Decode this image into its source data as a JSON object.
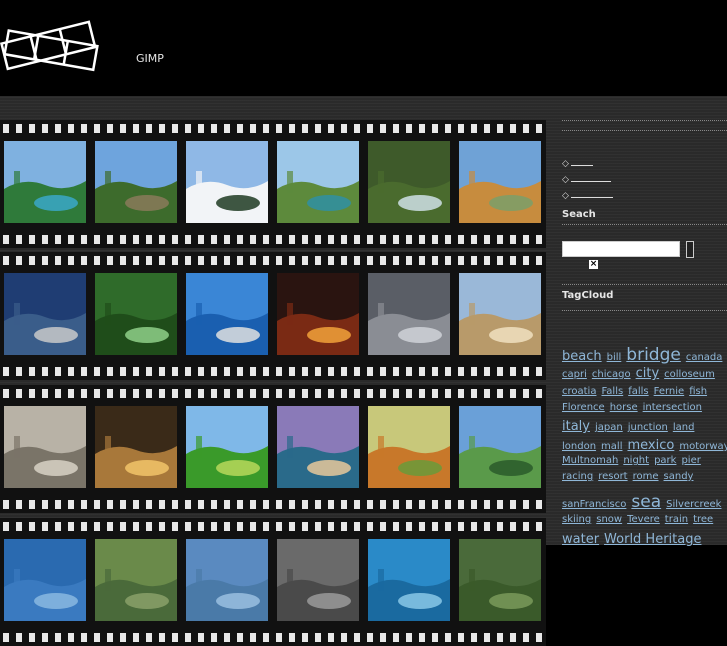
{
  "header": {
    "title": "GIMP"
  },
  "nav": {
    "items": [
      "",
      "",
      ""
    ]
  },
  "search": {
    "title": "Seach",
    "placeholder": ""
  },
  "tagcloud": {
    "title": "TagCloud",
    "rows": [
      [
        {
          "t": "beach",
          "s": 13
        },
        {
          "t": "bill",
          "s": 10
        },
        {
          "t": "bridge",
          "s": 17
        },
        {
          "t": "canada",
          "s": 10
        }
      ],
      [
        {
          "t": "capri",
          "s": 10
        },
        {
          "t": "chicago",
          "s": 10
        },
        {
          "t": "city",
          "s": 13
        },
        {
          "t": "colloseum",
          "s": 10
        }
      ],
      [
        {
          "t": "croatia",
          "s": 10
        },
        {
          "t": "Falls",
          "s": 10
        },
        {
          "t": "falls",
          "s": 10
        },
        {
          "t": "Fernie",
          "s": 10
        },
        {
          "t": "fish",
          "s": 10
        }
      ],
      [
        {
          "t": "Florence",
          "s": 10
        },
        {
          "t": "horse",
          "s": 10
        },
        {
          "t": "intersection",
          "s": 10
        }
      ],
      [
        {
          "t": "italy",
          "s": 13
        },
        {
          "t": "japan",
          "s": 10
        },
        {
          "t": "junction",
          "s": 10
        },
        {
          "t": "land",
          "s": 10
        }
      ],
      [
        {
          "t": "london",
          "s": 10
        },
        {
          "t": "mall",
          "s": 10
        },
        {
          "t": "mexico",
          "s": 13
        },
        {
          "t": "motorway",
          "s": 10
        }
      ],
      [
        {
          "t": "Multnomah",
          "s": 10
        },
        {
          "t": "night",
          "s": 10
        },
        {
          "t": "park",
          "s": 10
        },
        {
          "t": "pier",
          "s": 10
        }
      ],
      [
        {
          "t": "racing",
          "s": 10
        },
        {
          "t": "resort",
          "s": 10
        },
        {
          "t": "rome",
          "s": 10
        },
        {
          "t": "sandy",
          "s": 10
        }
      ],
      [
        {
          "t": "sanFrancisco",
          "s": 10
        },
        {
          "t": "sea",
          "s": 17
        },
        {
          "t": "Silvercreek",
          "s": 10
        }
      ],
      [
        {
          "t": "skiing",
          "s": 10
        },
        {
          "t": "snow",
          "s": 10
        },
        {
          "t": "Tevere",
          "s": 10
        },
        {
          "t": "train",
          "s": 10
        },
        {
          "t": "tree",
          "s": 10
        }
      ],
      [
        {
          "t": "water",
          "s": 13
        },
        {
          "t": "World Heritage",
          "s": 13
        }
      ]
    ]
  },
  "photos": [
    [
      {
        "icon": "resort-pool-photo",
        "sky": "#7fb1e0",
        "ground": "#2f7a3a",
        "accent": "#39a8c9"
      },
      {
        "icon": "countryside-photo",
        "sky": "#6ea4dd",
        "ground": "#3d6b2c",
        "accent": "#8a7a5a"
      },
      {
        "icon": "snow-forest-photo",
        "sky": "#8fb8e6",
        "ground": "#f2f4f7",
        "accent": "#1f3a22"
      },
      {
        "icon": "lagoon-photo",
        "sky": "#9cc7e8",
        "ground": "#5d8a3c",
        "accent": "#2f8fa3"
      },
      {
        "icon": "waterfall-bridge-photo",
        "sky": "#3e5a2a",
        "ground": "#4a6b2e",
        "accent": "#cfe0e6"
      },
      {
        "icon": "florence-bridge-photo",
        "sky": "#6fa2d6",
        "ground": "#c78c3e",
        "accent": "#7a9f6a"
      }
    ],
    [
      {
        "icon": "highway-junction-photo",
        "sky": "#1f3d73",
        "ground": "#3a5d8a",
        "accent": "#c9c9c9"
      },
      {
        "icon": "forest-stream-photo",
        "sky": "#2f6b2a",
        "ground": "#1f4d1a",
        "accent": "#8fd08a"
      },
      {
        "icon": "pier-sea-photo",
        "sky": "#3a86d6",
        "ground": "#1a5fb0",
        "accent": "#e0e0e0"
      },
      {
        "icon": "city-night-photo",
        "sky": "#2a1410",
        "ground": "#7a2a14",
        "accent": "#f2a23a"
      },
      {
        "icon": "aerial-city-photo",
        "sky": "#5a5e66",
        "ground": "#8a8d94",
        "accent": "#cfd2d8"
      },
      {
        "icon": "chicago-skyline-photo",
        "sky": "#9ab8d8",
        "ground": "#b89a6a",
        "accent": "#f0e0c0"
      }
    ],
    [
      {
        "icon": "colosseum-photo",
        "sky": "#b8b2a6",
        "ground": "#7a7468",
        "accent": "#d8d2c6"
      },
      {
        "icon": "mall-interior-photo",
        "sky": "#3a2a18",
        "ground": "#a8783a",
        "accent": "#f2c46a"
      },
      {
        "icon": "green-hills-photo",
        "sky": "#7fb8e8",
        "ground": "#3a9a2a",
        "accent": "#b8d85a"
      },
      {
        "icon": "palm-shore-photo",
        "sky": "#8a7ab8",
        "ground": "#2a6a8a",
        "accent": "#e8c89a"
      },
      {
        "icon": "autumn-village-photo",
        "sky": "#c8c87a",
        "ground": "#c8782a",
        "accent": "#6a9a3a"
      },
      {
        "icon": "park-trees-photo",
        "sky": "#6aa0d8",
        "ground": "#5a9a4a",
        "accent": "#2a5a2a"
      }
    ],
    [
      {
        "icon": "photo-partial-1",
        "sky": "#2a6ab0",
        "ground": "#3a7ac0",
        "accent": "#8ab8e0"
      },
      {
        "icon": "photo-partial-2",
        "sky": "#6a8a4a",
        "ground": "#4a6a3a",
        "accent": "#8aa06a"
      },
      {
        "icon": "photo-partial-3",
        "sky": "#5a8ac0",
        "ground": "#4a7aa8",
        "accent": "#9ac0e0"
      },
      {
        "icon": "photo-partial-4",
        "sky": "#6a6a6a",
        "ground": "#4a4a4a",
        "accent": "#9a9a9a"
      },
      {
        "icon": "photo-partial-5",
        "sky": "#2a8ac8",
        "ground": "#1a6aa0",
        "accent": "#8ac8e8"
      },
      {
        "icon": "photo-partial-6",
        "sky": "#4a6a3a",
        "ground": "#3a5a2a",
        "accent": "#7a9a5a"
      }
    ]
  ]
}
